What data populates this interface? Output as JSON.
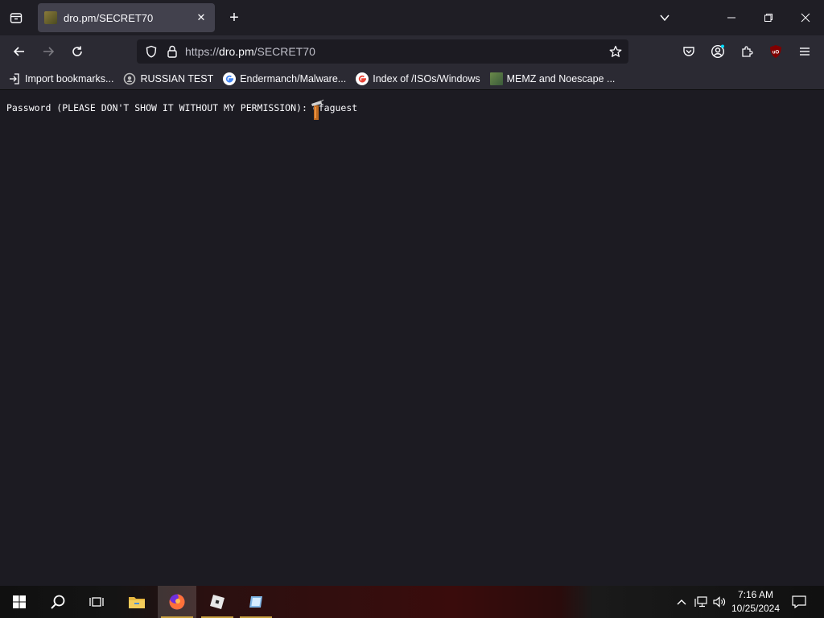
{
  "browser": {
    "tab": {
      "title": "dro.pm/SECRET70",
      "close_icon": "close-icon"
    },
    "url": {
      "scheme": "https://",
      "domain": "dro.pm",
      "path": "/SECRET70"
    },
    "bookmarks": [
      {
        "label": "Import bookmarks...",
        "icon": "import-icon"
      },
      {
        "label": "RUSSIAN TEST",
        "icon": "github-icon"
      },
      {
        "label": "Endermanch/Malware...",
        "icon": "google-icon"
      },
      {
        "label": "Index of /ISOs/Windows",
        "icon": "google-icon"
      },
      {
        "label": "MEMZ and Noescape ...",
        "icon": "memz-icon"
      }
    ]
  },
  "page": {
    "text": "Password (PLEASE DON'T SHOW IT WITHOUT MY PERMISSION):",
    "value": "efaguest"
  },
  "taskbar": {
    "clock": {
      "time": "7:16 AM",
      "date": "10/25/2024"
    }
  },
  "colors": {
    "background": "#1c1b22",
    "tab_active": "#42414d",
    "toolbar": "#2b2a33",
    "text": "#fbfbfe",
    "ublock": "#800000"
  }
}
